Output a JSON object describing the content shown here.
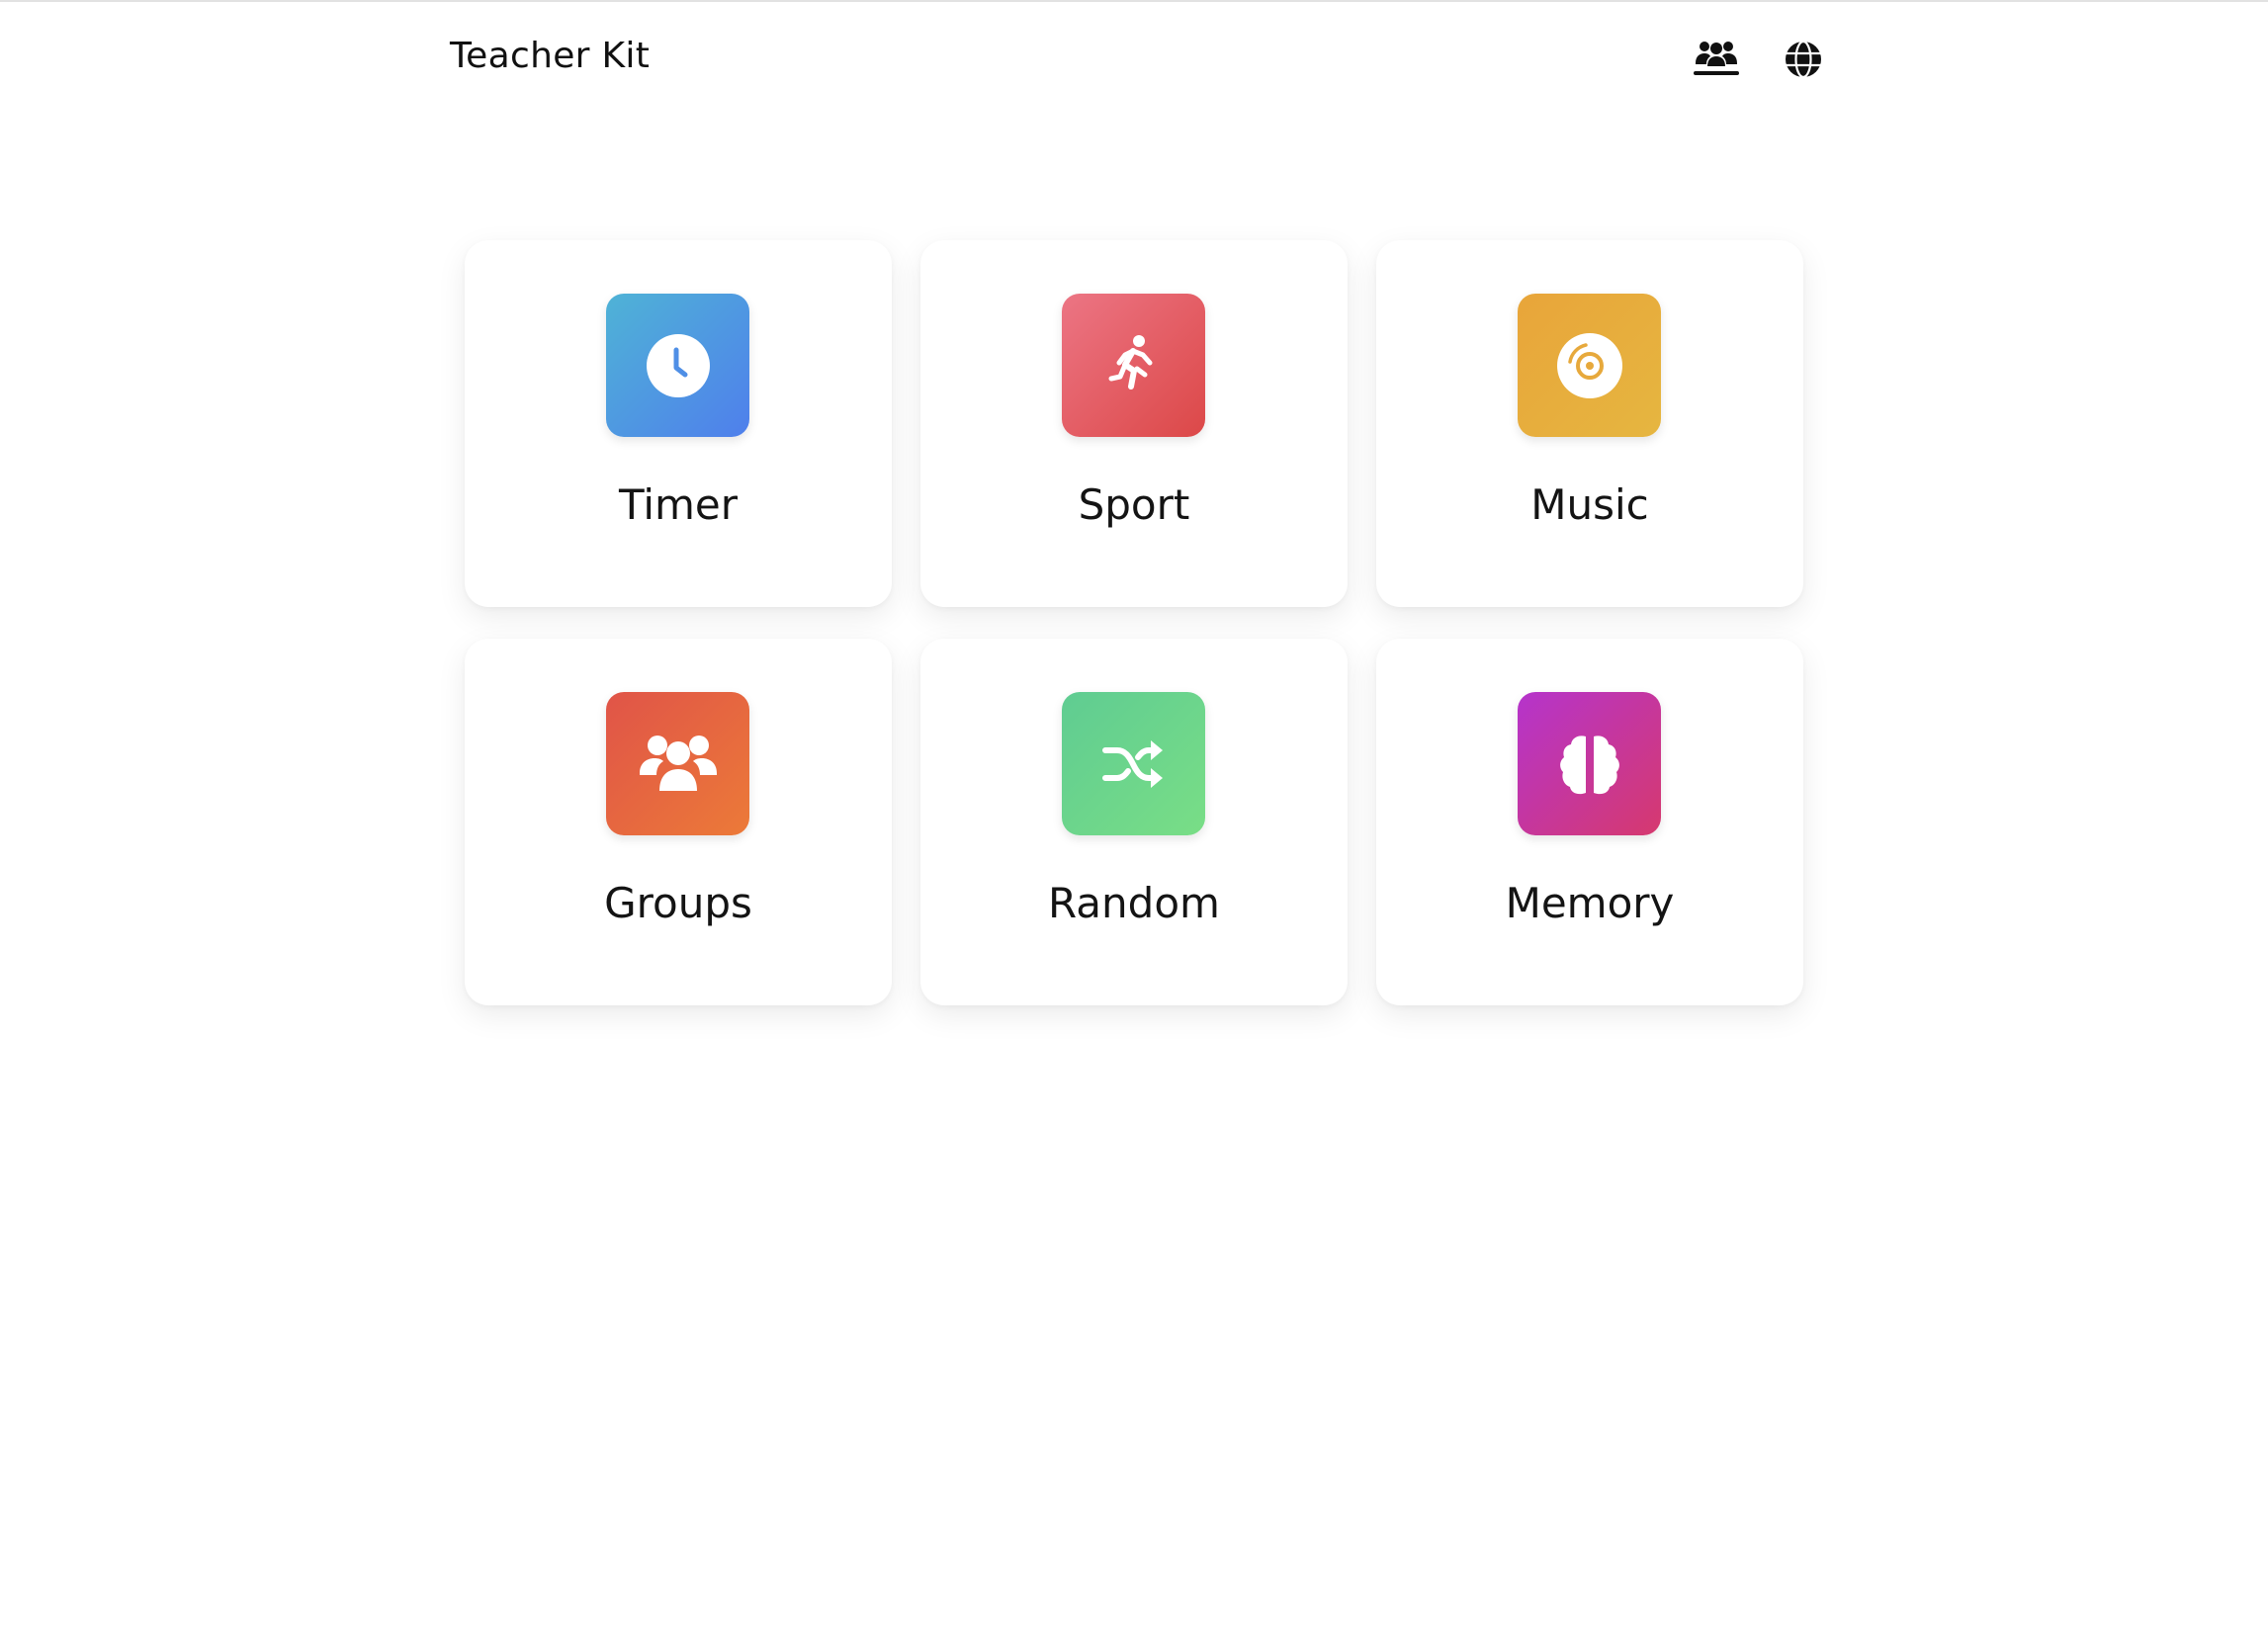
{
  "header": {
    "title": "Teacher Kit",
    "groups_icon": "groups-icon",
    "language_icon": "globe-icon"
  },
  "tools": [
    {
      "label": "Timer",
      "icon": "clock-icon",
      "gradient": [
        "#4fb3d6",
        "#4f7fec"
      ]
    },
    {
      "label": "Sport",
      "icon": "running-icon",
      "gradient": [
        "#ec7584",
        "#dc4848"
      ]
    },
    {
      "label": "Music",
      "icon": "disc-icon",
      "gradient": [
        "#e8a53a",
        "#e6b640"
      ]
    },
    {
      "label": "Groups",
      "icon": "users-icon",
      "gradient": [
        "#e05448",
        "#ec7a38"
      ]
    },
    {
      "label": "Random",
      "icon": "shuffle-icon",
      "gradient": [
        "#5fcc92",
        "#79de86"
      ]
    },
    {
      "label": "Memory",
      "icon": "brain-icon",
      "gradient": [
        "#b534cc",
        "#d6396e"
      ]
    }
  ]
}
